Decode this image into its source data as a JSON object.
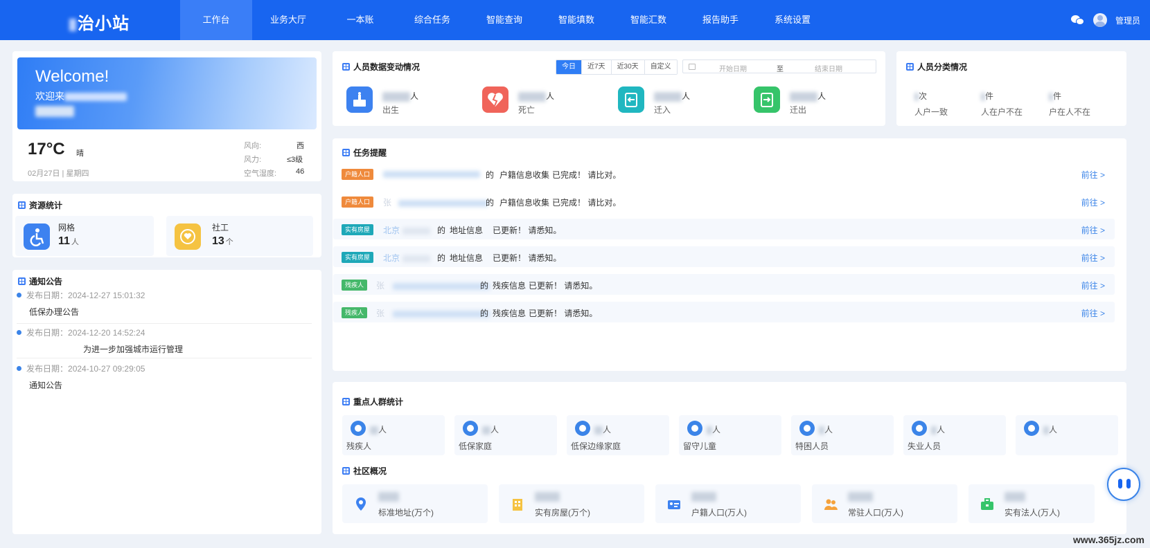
{
  "header": {
    "logo_text": "治小站",
    "nav": [
      "工作台",
      "业务大厅",
      "一本账",
      "综合任务",
      "智能查询",
      "智能填数",
      "智能汇数",
      "报告助手",
      "系统设置"
    ],
    "active_nav": "工作台",
    "username": "管理员"
  },
  "welcome": {
    "title": "Welcome!",
    "subtitle": "欢迎来"
  },
  "weather": {
    "temp": "17°C",
    "condition": "晴",
    "date": "02月27日",
    "weekday": "星期四",
    "wind_dir_label": "风向:",
    "wind_dir": "西",
    "wind_force_label": "风力:",
    "wind_force": "≤3级",
    "humidity_label": "空气湿度:",
    "humidity": "46"
  },
  "resources": {
    "title": "资源统计",
    "items": [
      {
        "label": "网格",
        "value": "11",
        "unit": "人"
      },
      {
        "label": "社工",
        "value": "13",
        "unit": "个"
      }
    ]
  },
  "notices": {
    "title": "通知公告",
    "date_prefix": "发布日期：",
    "items": [
      {
        "date": "2024-12-27 15:01:32",
        "text": "低保办理公告"
      },
      {
        "date": "2024-12-20 14:52:24",
        "text": "为进一步加强城市运行管理"
      },
      {
        "date": "2024-10-27 09:29:05",
        "text": "通知公告"
      }
    ]
  },
  "person_change": {
    "title": "人员数据变动情况",
    "tabs": [
      "今日",
      "近7天",
      "近30天",
      "自定义"
    ],
    "active_tab": "今日",
    "start_placeholder": "开始日期",
    "range_sep": "至",
    "end_placeholder": "结束日期",
    "items": [
      {
        "unit": "人",
        "label": "出生",
        "color": "#3d82f0"
      },
      {
        "unit": "人",
        "label": "死亡",
        "color": "#f0645a"
      },
      {
        "unit": "人",
        "label": "迁入",
        "color": "#20b7c0"
      },
      {
        "unit": "人",
        "label": "迁出",
        "color": "#36c46a"
      }
    ]
  },
  "classification": {
    "title": "人员分类情况",
    "items": [
      {
        "unit": "次",
        "label": "人户一致"
      },
      {
        "unit": "件",
        "label": "人在户不在"
      },
      {
        "unit": "件",
        "label": "户在人不在"
      }
    ]
  },
  "tasks": {
    "title": "任务提醒",
    "go_label": "前往 >",
    "items": [
      {
        "tag": "户籍人口",
        "tag_color": "orange",
        "prefix": "",
        "of": "的",
        "link": "户籍信息收集",
        "status": "已完成！ 请比对。"
      },
      {
        "tag": "户籍人口",
        "tag_color": "orange",
        "prefix": "张",
        "of": "的",
        "link": "户籍信息收集",
        "status": "已完成！ 请比对。"
      },
      {
        "tag": "实有房屋",
        "tag_color": "teal",
        "prefix": "北京",
        "of": "的",
        "link": "地址信息",
        "status": "已更新！ 请悉知。"
      },
      {
        "tag": "实有房屋",
        "tag_color": "teal",
        "prefix": "北京",
        "of": "的",
        "link": "地址信息",
        "status": "已更新！ 请悉知。"
      },
      {
        "tag": "残疾人",
        "tag_color": "green",
        "prefix": "张",
        "of": "的",
        "link": "残疾信息",
        "status": "已更新！ 请悉知。"
      },
      {
        "tag": "残疾人",
        "tag_color": "green",
        "prefix": "张",
        "of": "的",
        "link": "残疾信息",
        "status": "已更新！ 请悉知。"
      }
    ]
  },
  "key_groups": {
    "title": "重点人群统计",
    "items": [
      {
        "unit": "人",
        "label": "残疾人"
      },
      {
        "unit": "人",
        "label": "低保家庭"
      },
      {
        "unit": "人",
        "label": "低保边缘家庭"
      },
      {
        "unit": "人",
        "label": "留守儿童"
      },
      {
        "unit": "人",
        "label": "特困人员"
      },
      {
        "unit": "人",
        "label": "失业人员"
      },
      {
        "unit": "人",
        "label": ""
      }
    ]
  },
  "community": {
    "title": "社区概况",
    "items": [
      {
        "label": "标准地址(万个)",
        "color": "#3d82f0"
      },
      {
        "label": "实有房屋(万个)",
        "color": "#f5c342"
      },
      {
        "label": "户籍人口(万人)",
        "color": "#3d82f0"
      },
      {
        "label": "常驻人口(万人)",
        "color": "#f5a23c"
      },
      {
        "label": "实有法人(万人)",
        "color": "#36c46a"
      }
    ]
  },
  "watermark": "www.365jz.com"
}
